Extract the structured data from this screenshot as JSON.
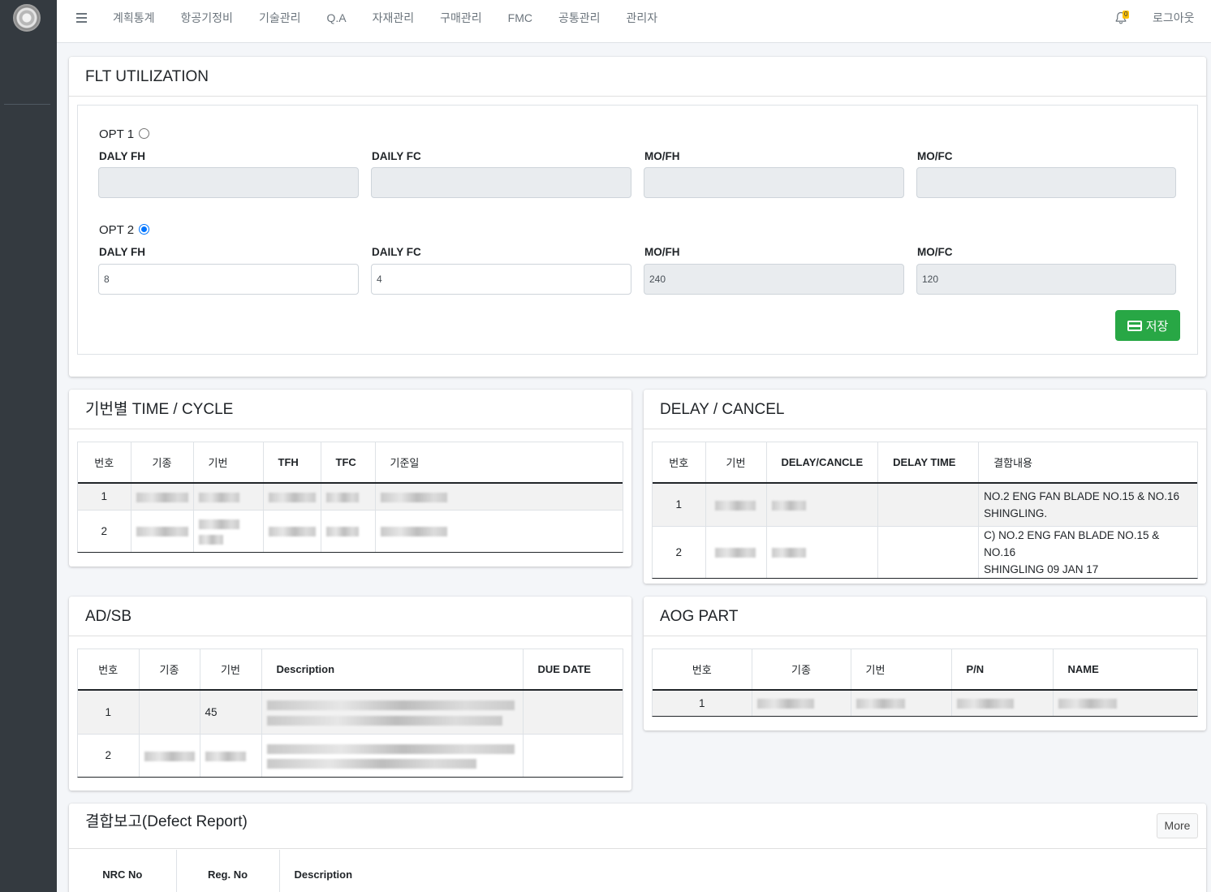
{
  "nav": {
    "menu": [
      "계획통계",
      "항공기정비",
      "기술관리",
      "Q.A",
      "자재관리",
      "구매관리",
      "FMC",
      "공통관리",
      "관리자"
    ],
    "badge": "0",
    "logout": "로그아웃"
  },
  "flt": {
    "title": "FLT UTILIZATION",
    "opt1": "OPT 1",
    "opt2": "OPT 2",
    "labels": [
      "DALY FH",
      "DAILY FC",
      "MO/FH",
      "MO/FC"
    ],
    "opt1_values": [
      "",
      "",
      "",
      ""
    ],
    "opt2_values": [
      "8",
      "4",
      "240",
      "120"
    ],
    "opt1_selected": false,
    "opt2_selected": true,
    "save": "저장"
  },
  "timecycle": {
    "title_kr": "기번별",
    "title_en": " TIME / CYCLE",
    "headers": [
      "번호",
      "기종",
      "기번",
      "TFH",
      "TFC",
      "기준일"
    ],
    "rows": [
      {
        "no": "1"
      },
      {
        "no": "2"
      }
    ]
  },
  "delay": {
    "title": "DELAY / CANCEL",
    "headers": [
      "번호",
      "기번",
      "DELAY/CANCLE",
      "DELAY TIME",
      "결함내용"
    ],
    "rows": [
      {
        "no": "1",
        "desc_1": "NO.2 ENG FAN BLADE NO.15 & NO.16",
        "desc_2": "SHINGLING."
      },
      {
        "no": "2",
        "desc_1": "C) NO.2 ENG FAN BLADE NO.15 & NO.16",
        "desc_2": "SHINGLING 09 JAN 17"
      }
    ]
  },
  "adsb": {
    "title": "AD/SB",
    "headers": [
      "번호",
      "기종",
      "기번",
      "Description",
      "DUE DATE"
    ],
    "rows": [
      {
        "no": "1",
        "regno": "45"
      },
      {
        "no": "2",
        "regno": ""
      }
    ]
  },
  "aog": {
    "title": "AOG PART",
    "headers": [
      "번호",
      "기종",
      "기번",
      "P/N",
      "NAME"
    ],
    "rows": [
      {
        "no": "1"
      }
    ]
  },
  "defect": {
    "title_kr": "결합보고",
    "title_en": "(Defect Report)",
    "more": "More",
    "headers": [
      "NRC No",
      "Reg. No",
      "Description"
    ]
  }
}
